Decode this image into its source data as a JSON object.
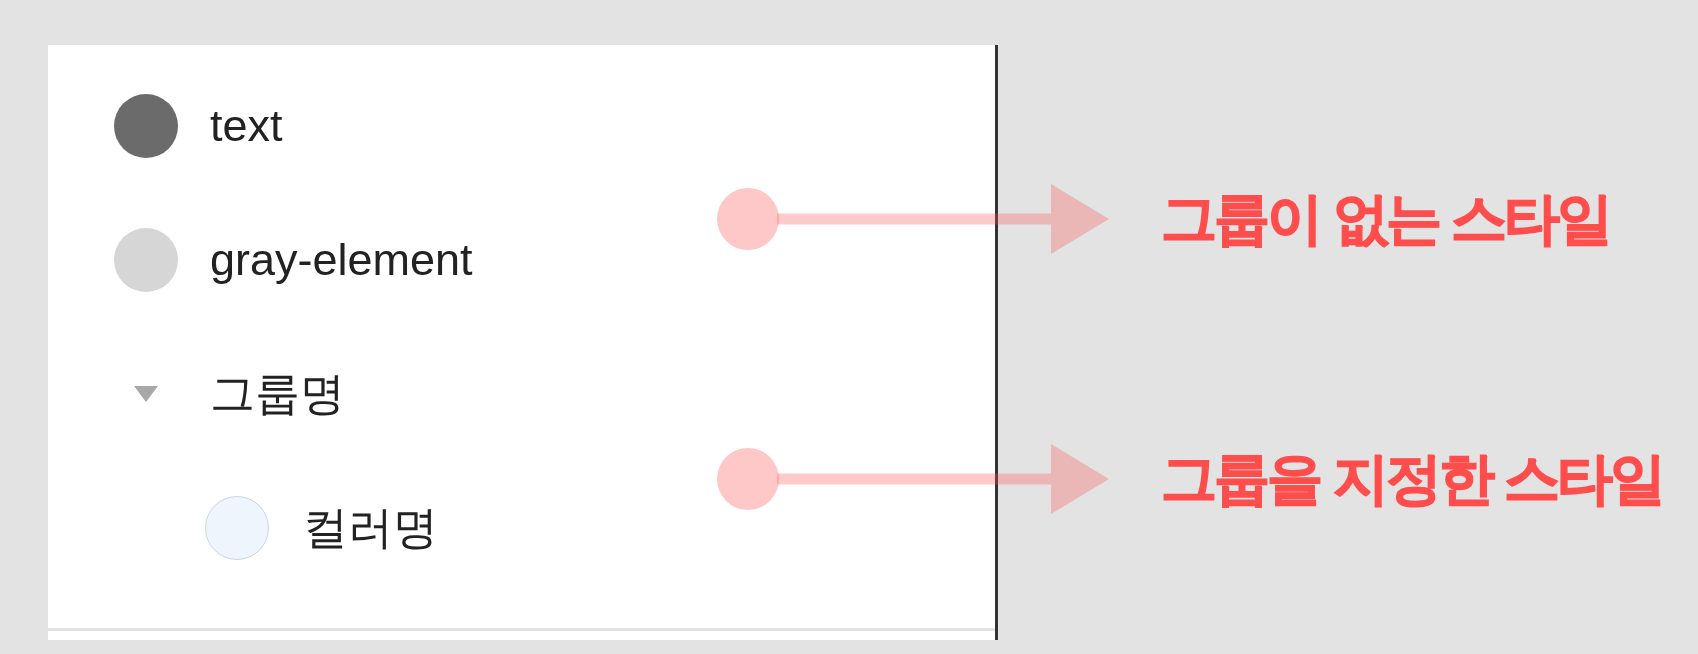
{
  "styles": [
    {
      "kind": "color",
      "name": "text",
      "color": "#6b6b6b"
    },
    {
      "kind": "color",
      "name": "gray-element",
      "color": "#d6d6d6"
    },
    {
      "kind": "group",
      "name": "그룹명",
      "expanded": true,
      "children": [
        {
          "kind": "color",
          "name": "컬러명",
          "color": "#eef5fd"
        }
      ]
    }
  ],
  "annotations": [
    {
      "label": "그룹이 없는 스타일"
    },
    {
      "label": "그룹을 지정한 스타일"
    }
  ]
}
